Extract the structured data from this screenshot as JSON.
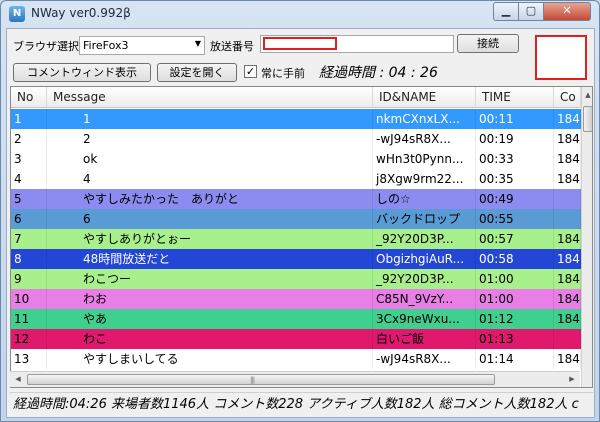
{
  "window": {
    "title": "NWay ver0.992β",
    "icon_letter": "N",
    "min_symbol": "▁",
    "max_symbol": "▢",
    "close_symbol": "✕"
  },
  "toolbar": {
    "browser_label": "ブラウザ選択",
    "browser_value": "FireFox3",
    "broadcast_label": "放送番号",
    "broadcast_value": "",
    "connect_label": "接続",
    "comment_window_label": "コメントウィンド表示",
    "settings_label": "設定を開く",
    "always_on_top_label": "常に手前",
    "always_on_top_checked": "✓",
    "elapsed_label": "経過時間 : 04 : 26"
  },
  "grid": {
    "columns": [
      "No",
      "Message",
      "ID&NAME",
      "TIME",
      "Co"
    ],
    "rows": [
      {
        "no": "1",
        "message": "1",
        "id": "nkmCXnxLX...",
        "time": "00:11",
        "co": "184",
        "bg": "#3399ff",
        "fg": "#ffffff"
      },
      {
        "no": "2",
        "message": "2",
        "id": "-wJ94sR8X...",
        "time": "00:19",
        "co": "184",
        "bg": "#ffffff",
        "fg": "#000000"
      },
      {
        "no": "3",
        "message": "ok",
        "id": "wHn3t0Pynn...",
        "time": "00:33",
        "co": "184",
        "bg": "#ffffff",
        "fg": "#000000"
      },
      {
        "no": "4",
        "message": "4",
        "id": "j8Xgw9rm22...",
        "time": "00:35",
        "co": "184",
        "bg": "#ffffff",
        "fg": "#000000"
      },
      {
        "no": "5",
        "message": "やすしみたかった　ありがと",
        "id": "しの☆",
        "time": "00:49",
        "co": "",
        "bg": "#8c8cf0",
        "fg": "#000000"
      },
      {
        "no": "6",
        "message": "6",
        "id": "バックドロップ",
        "time": "00:55",
        "co": "",
        "bg": "#5b9bd5",
        "fg": "#000000"
      },
      {
        "no": "7",
        "message": "やすしありがとぉー",
        "id": "_92Y20D3P...",
        "time": "00:57",
        "co": "184",
        "bg": "#a8f08c",
        "fg": "#000000"
      },
      {
        "no": "8",
        "message": "48時間放送だと",
        "id": "ObgizhgiAuR...",
        "time": "00:58",
        "co": "184",
        "bg": "#2446d6",
        "fg": "#ffffff"
      },
      {
        "no": "9",
        "message": "わこつー",
        "id": "_92Y20D3P...",
        "time": "01:00",
        "co": "184",
        "bg": "#a8f08c",
        "fg": "#000000"
      },
      {
        "no": "10",
        "message": "わお",
        "id": "C85N_9VzY...",
        "time": "01:00",
        "co": "184",
        "bg": "#e87ee6",
        "fg": "#000000"
      },
      {
        "no": "11",
        "message": "やあ",
        "id": "3Cx9neWxu...",
        "time": "01:12",
        "co": "184",
        "bg": "#3fcf8f",
        "fg": "#000000"
      },
      {
        "no": "12",
        "message": "わこ",
        "id": "白いご飯",
        "time": "01:13",
        "co": "",
        "bg": "#e0196e",
        "fg": "#000000"
      },
      {
        "no": "13",
        "message": "やすしまいしてる",
        "id": "-wJ94sR8X...",
        "time": "01:14",
        "co": "184",
        "bg": "#ffffff",
        "fg": "#000000"
      }
    ]
  },
  "status": {
    "text": "経過時間:04:26 来場者数1146人 コメント数228 アクティブ人数182人 総コメント人数182人 c"
  },
  "colors": {
    "red_marker": "#e02020"
  }
}
